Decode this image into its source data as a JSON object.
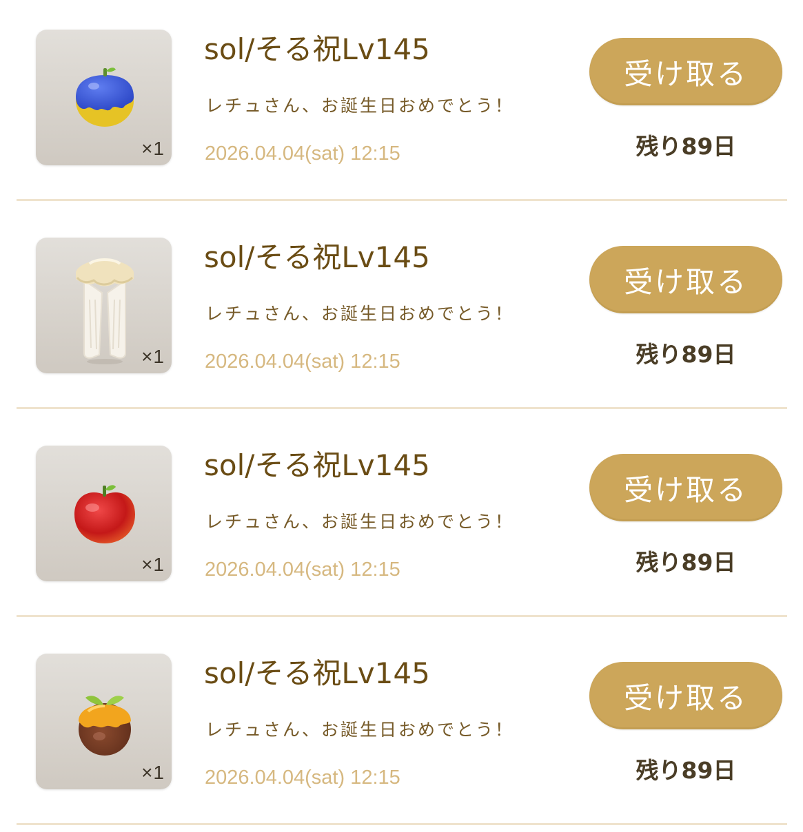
{
  "colors": {
    "title": "#6a4c14",
    "message": "#765a28",
    "date": "#d6b880",
    "button_bg": "#cca65a",
    "button_text": "#ffffff",
    "days_left": "#4a3d26",
    "divider": "#efe3cd",
    "tile_bg": "#d8d4ce"
  },
  "mail_list": {
    "items": [
      {
        "item_icon": "blue-yellow-fruit-icon",
        "quantity": "×1",
        "title": "sol/そる祝Lv145",
        "message": "レチュさん、お誕生日おめでとう！",
        "date": "2026.04.04(sat) 12:15",
        "button_label": "受け取る",
        "days_left": "残り89日"
      },
      {
        "item_icon": "cream-ruffle-tights-icon",
        "quantity": "×1",
        "title": "sol/そる祝Lv145",
        "message": "レチュさん、お誕生日おめでとう！",
        "date": "2026.04.04(sat) 12:15",
        "button_label": "受け取る",
        "days_left": "残り89日"
      },
      {
        "item_icon": "red-apple-icon",
        "quantity": "×1",
        "title": "sol/そる祝Lv145",
        "message": "レチュさん、お誕生日おめでとう！",
        "date": "2026.04.04(sat) 12:15",
        "button_label": "受け取る",
        "days_left": "残り89日"
      },
      {
        "item_icon": "brown-orange-fruit-icon",
        "quantity": "×1",
        "title": "sol/そる祝Lv145",
        "message": "レチュさん、お誕生日おめでとう！",
        "date": "2026.04.04(sat) 12:15",
        "button_label": "受け取る",
        "days_left": "残り89日"
      }
    ]
  }
}
